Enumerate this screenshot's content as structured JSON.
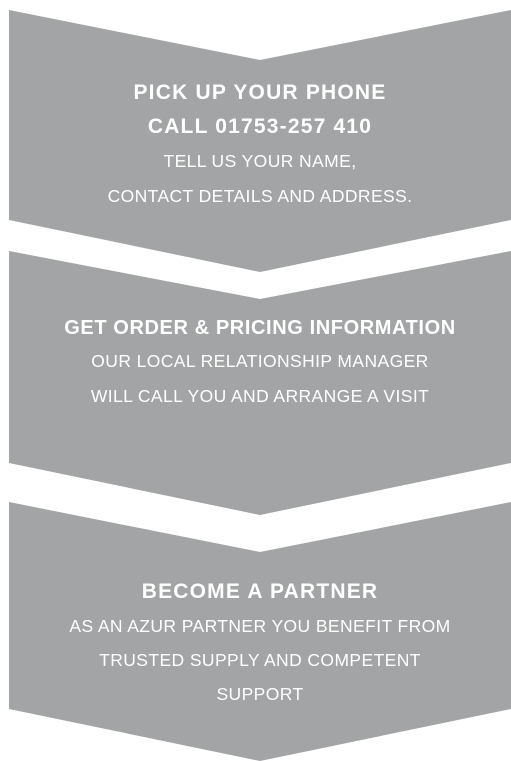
{
  "steps": [
    {
      "title_lines": [
        "PICK UP YOUR PHONE",
        "CALL 01753-257 410"
      ],
      "body_lines": [
        "TELL US YOUR NAME,",
        "CONTACT DETAILS AND ADDRESS."
      ]
    },
    {
      "title_lines": [
        "GET ORDER & PRICING INFORMATION"
      ],
      "body_lines": [
        "OUR LOCAL RELATIONSHIP MANAGER",
        "WILL CALL YOU AND ARRANGE A VISIT"
      ]
    },
    {
      "title_lines": [
        "BECOME A PARTNER"
      ],
      "body_lines": [
        "AS AN AZUR PARTNER YOU BENEFIT FROM",
        "TRUSTED SUPPLY AND COMPETENT",
        "SUPPORT"
      ]
    }
  ],
  "colors": {
    "chevron_fill": "#a3a4a6",
    "text": "#ffffff",
    "background": "#ffffff"
  }
}
